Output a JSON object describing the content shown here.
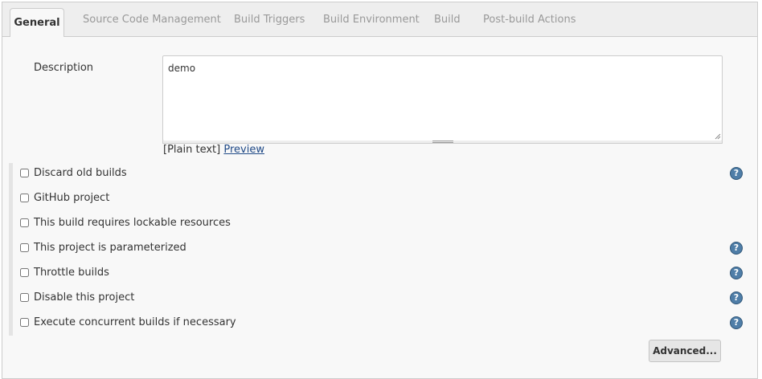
{
  "tabs": [
    {
      "label": "General",
      "active": true
    },
    {
      "label": "Source Code Management",
      "active": false
    },
    {
      "label": "Build Triggers",
      "active": false
    },
    {
      "label": "Build Environment",
      "active": false
    },
    {
      "label": "Build",
      "active": false
    },
    {
      "label": "Post-build Actions",
      "active": false
    }
  ],
  "description": {
    "label": "Description",
    "value": "demo",
    "plain_text": "[Plain text]",
    "preview_link": "Preview"
  },
  "options": [
    {
      "label": "Discard old builds",
      "checked": false,
      "help_icon": "help-icon",
      "has_help": true
    },
    {
      "label": "GitHub project",
      "checked": false,
      "has_help": false
    },
    {
      "label": "This build requires lockable resources",
      "checked": false,
      "has_help": false
    },
    {
      "label": "This project is parameterized",
      "checked": false,
      "help_icon": "help-icon",
      "has_help": true
    },
    {
      "label": "Throttle builds",
      "checked": false,
      "help_icon": "help-icon",
      "has_help": true
    },
    {
      "label": "Disable this project",
      "checked": false,
      "help_icon": "help-icon",
      "has_help": true
    },
    {
      "label": "Execute concurrent builds if necessary",
      "checked": false,
      "help_icon": "help-icon",
      "has_help": true
    }
  ],
  "help_glyph": "?",
  "advanced_button": "Advanced...",
  "colors": {
    "link": "#204a87",
    "help_icon": "#4f7ea8",
    "tab_inactive": "#999999"
  }
}
